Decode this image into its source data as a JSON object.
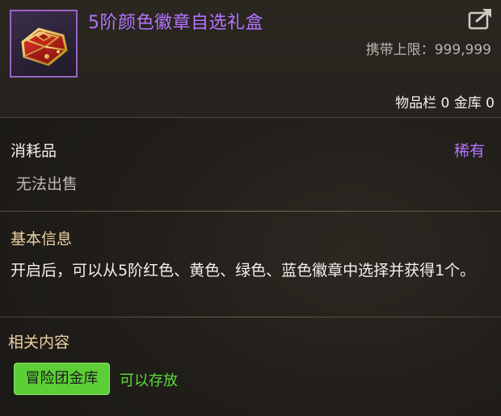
{
  "item": {
    "title": "5阶颜色徽章自选礼盒",
    "icon": "red-gift-box-icon",
    "carry_limit_label": "携带上限：",
    "carry_limit_value": "999,999",
    "inventory_text": "物品栏 0 金库 0"
  },
  "meta": {
    "type": "消耗品",
    "rarity": "稀有",
    "sell_status": "无法出售"
  },
  "basic_info": {
    "title": "基本信息",
    "description": "开启后，可以从5阶红色、黄色、绿色、蓝色徽章中选择并获得1个。"
  },
  "related": {
    "title": "相关内容",
    "badge": "冒险团金库",
    "status": "可以存放"
  },
  "colors": {
    "rarity_purple": "#b574ff",
    "section_gold": "#ecd3a2",
    "badge_green": "#5ccf37",
    "status_green": "#5edc3a"
  },
  "icons": {
    "share": "share-export-icon"
  }
}
